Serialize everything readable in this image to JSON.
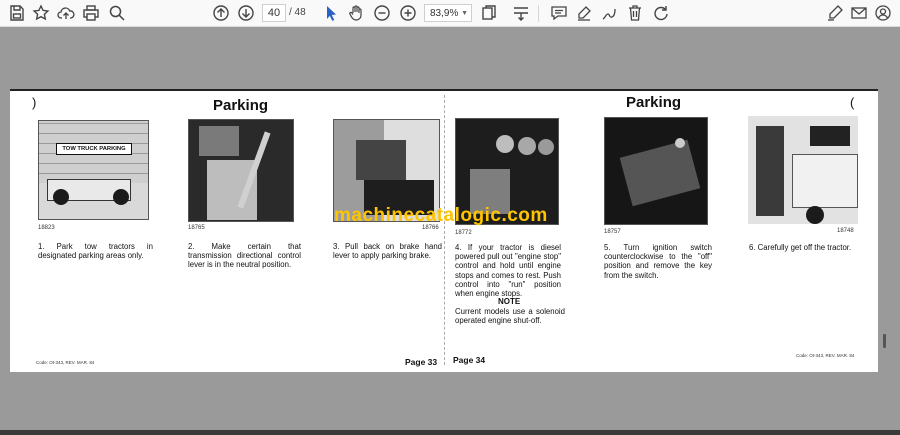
{
  "toolbar": {
    "page_current": "40",
    "page_total": "/ 48",
    "zoom": "83,9%",
    "icons": [
      "save-icon",
      "bookmark-star-icon",
      "cloud-upload-icon",
      "print-icon",
      "zoom-search-icon",
      "page-up-icon",
      "page-down-icon",
      "select-cursor-icon",
      "hand-pan-icon",
      "zoom-out-icon",
      "zoom-in-icon",
      "fit-page-icon",
      "scroll-mode-icon",
      "comment-icon",
      "highlight-pen-icon",
      "draw-pen-icon",
      "delete-icon",
      "undo-icon",
      "sign-icon",
      "email-icon",
      "account-icon"
    ]
  },
  "document": {
    "left_page": {
      "heading": "Parking",
      "page_number": "Page 33",
      "code": "Code: Ot-343, REV. MAR. 84",
      "steps": [
        {
          "fig": "18823",
          "text": "1. Park tow tractors in designated parking areas only.",
          "sign": "TOW TRUCK PARKING"
        },
        {
          "fig": "18765",
          "text": "2. Make certain that transmission directional control lever is in the neutral position."
        },
        {
          "fig": "18766",
          "text": "3. Pull back on brake hand lever to apply parking brake."
        }
      ]
    },
    "right_page": {
      "heading": "Parking",
      "page_number": "Page 34",
      "code": "Code: Ot-343, REV. MAR. 84",
      "steps": [
        {
          "fig": "18772",
          "text": "4. If your tractor is diesel powered pull out \"engine stop\" control and hold until engine stops and comes to rest. Push control into \"run\" position when engine stops."
        },
        {
          "fig": "18757",
          "text": "5. Turn ignition switch counterclockwise to the \"off\" position and remove the key from the switch."
        },
        {
          "fig": "18748",
          "text": "6. Carefully get off the tractor."
        }
      ],
      "note_heading": "NOTE",
      "note_text": "Current models use a solenoid operated engine shut-off."
    },
    "watermark": "machinecatalogic.com"
  }
}
